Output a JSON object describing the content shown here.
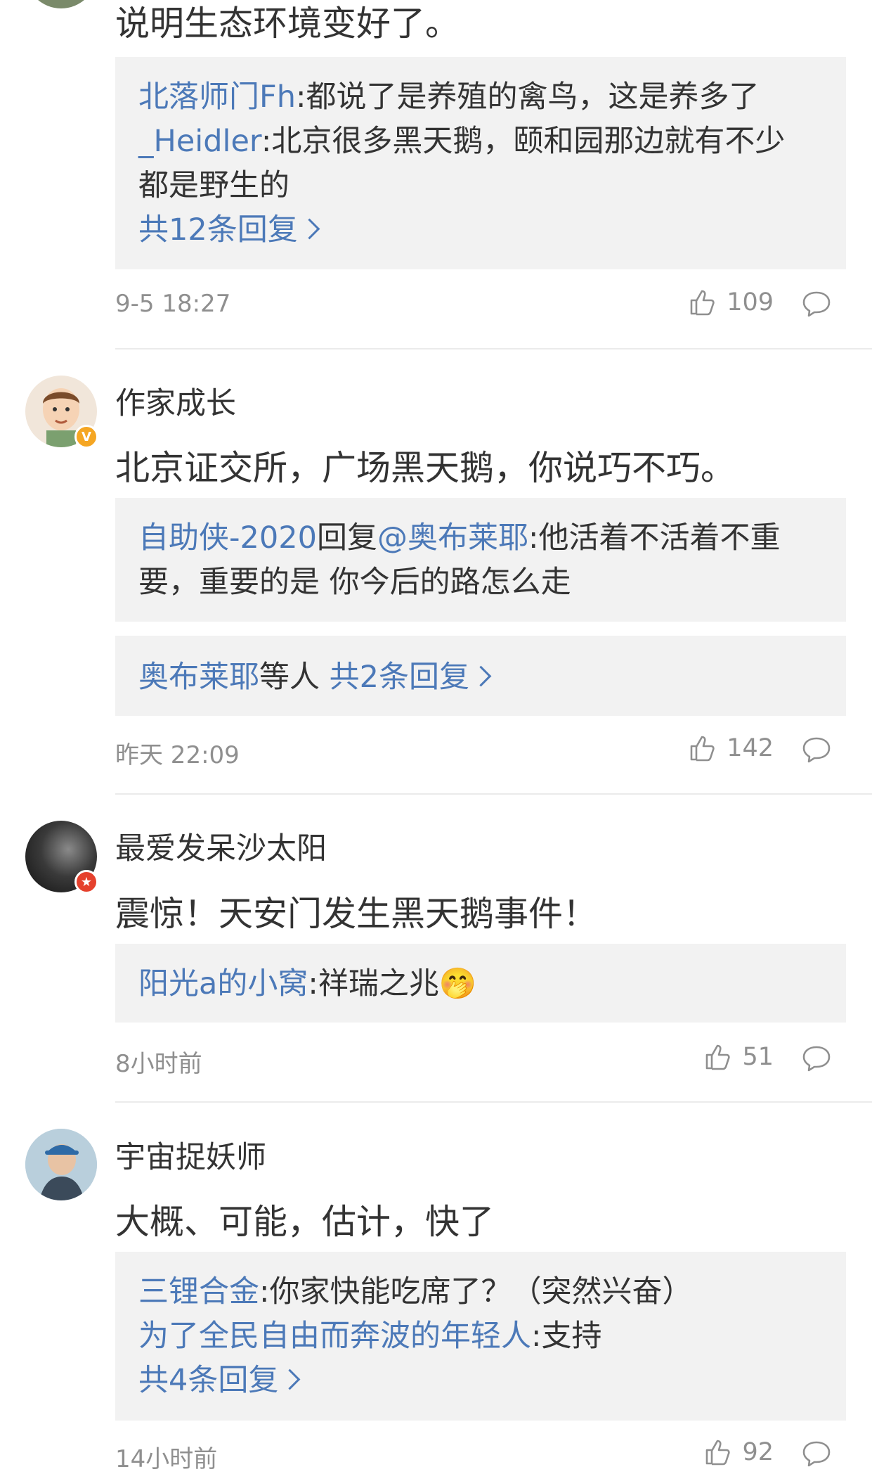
{
  "comments": [
    {
      "content": "说明生态环境变好了。",
      "replies": [
        {
          "user": "北落师门Fh",
          "text": ":都说了是养殖的禽鸟，这是养多了"
        },
        {
          "user": "_Heidler",
          "text": ":北京很多黑天鹅，颐和园那边就有不少"
        },
        {
          "user": "",
          "text": "都是野生的"
        }
      ],
      "more": "共12条回复",
      "time": "9-5 18:27",
      "likes": "109"
    },
    {
      "username": "作家成长",
      "content": "北京证交所，广场黑天鹅，你说巧不巧。",
      "reply_box": {
        "user": "自助侠-2020",
        "mid": "回复",
        "mention": "@奥布莱耶",
        "text1": ":他活着不活着不重",
        "text2": "要，重要的是 你今后的路怎么走"
      },
      "others": {
        "user": "奥布莱耶",
        "mid": "等人 ",
        "more": "共2条回复"
      },
      "time": "昨天 22:09",
      "likes": "142"
    },
    {
      "username": "最爱发呆沙太阳",
      "content": "震惊！天安门发生黑天鹅事件！",
      "reply": {
        "user": "阳光a的小窝",
        "text": ":祥瑞之兆",
        "emoji": "🤭"
      },
      "time": "8小时前",
      "likes": "51"
    },
    {
      "username": "宇宙捉妖师",
      "content": "大概、可能，估计，快了",
      "replies": [
        {
          "user": "三锂合金",
          "text": ":你家快能吃席了？（突然兴奋）"
        },
        {
          "user": "为了全民自由而奔波的年轻人",
          "text": ":支持"
        }
      ],
      "more": "共4条回复",
      "time": "14小时前",
      "likes": "92"
    }
  ],
  "colors": {
    "link": "#4c79b8",
    "meta": "#8f8f8f",
    "reply_bg": "#f2f2f2",
    "badge_gold": "#f5a623",
    "badge_red": "#e5412d"
  }
}
